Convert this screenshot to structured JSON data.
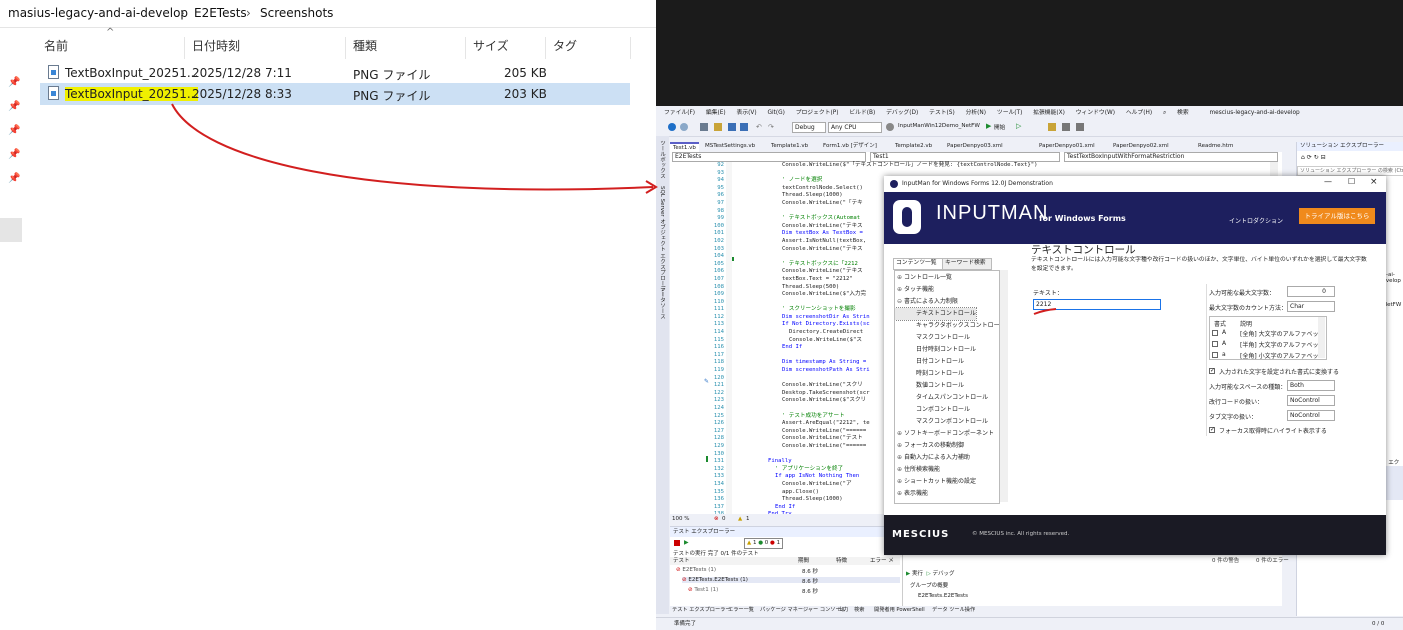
{
  "explorer": {
    "breadcrumb": [
      "masius-legacy-and-ai-develop",
      "E2ETests",
      "Screenshots"
    ],
    "columns": [
      "名前",
      "日付時刻",
      "種類",
      "サイズ",
      "タグ"
    ],
    "files": [
      {
        "name": "TextBoxInput_20251...",
        "date": "2025/12/28 7:11",
        "type": "PNG ファイル",
        "size": "205 KB",
        "selected": false
      },
      {
        "name": "TextBoxInput_20251...",
        "date": "2025/12/28 8:33",
        "type": "PNG ファイル",
        "size": "203 KB",
        "selected": true
      }
    ]
  },
  "vs": {
    "menu": [
      "ファイル(F)",
      "編集(E)",
      "表示(V)",
      "Git(G)",
      "プロジェクト(P)",
      "ビルド(B)",
      "デバッグ(D)",
      "テスト(S)",
      "分析(N)",
      "ツール(T)",
      "拡張機能(X)",
      "ウィンドウ(W)",
      "ヘルプ(H)"
    ],
    "search": "検索",
    "solution": "mescius-legacy-and-ai-develop",
    "toolbar": {
      "config": "Debug",
      "platform": "Any CPU",
      "project": "InputManWin12Demo_NetFW",
      "start": "開始"
    },
    "doc_tabs": [
      "Test1.vb",
      "MSTestSettings.vb",
      "Template1.vb",
      "Form1.vb [デザイン]",
      "Template2.vb",
      "PaperDenpyo03.xml",
      "PaperDenpyo01.xml",
      "PaperDenpyo02.xml",
      "Readme.htm"
    ],
    "nav": {
      "project": "E2ETests",
      "class": "Test1",
      "member": "TestTextBoxInputWithFormatRestriction"
    },
    "side_tabs": [
      "ツールボックス",
      "SQL Server オブジェクト エクスプローラー",
      "データソース"
    ],
    "line_numbers": [
      "92",
      "93",
      "94",
      "95",
      "96",
      "97",
      "98",
      "99",
      "100",
      "101",
      "102",
      "103",
      "104",
      "105",
      "106",
      "107",
      "108",
      "109",
      "110",
      "111",
      "112",
      "113",
      "114",
      "115",
      "116",
      "117",
      "118",
      "119",
      "120",
      "121",
      "122",
      "123",
      "124",
      "125",
      "126",
      "127",
      "128",
      "129",
      "130",
      "131",
      "132",
      "133",
      "134",
      "135",
      "136",
      "137",
      "138",
      "139",
      "140",
      "141",
      "142"
    ],
    "code_lines": [
      {
        "t": "Console.WriteLine($\"「テキストコントロール」ノードを発見: {textControlNode.Text}\")",
        "c": "n",
        "i": 6
      },
      {
        "t": "",
        "c": "n",
        "i": 0
      },
      {
        "t": "' ノードを選択",
        "c": "cm",
        "i": 6
      },
      {
        "t": "textControlNode.Select()",
        "c": "n",
        "i": 6
      },
      {
        "t": "Thread.Sleep(1000)",
        "c": "n",
        "i": 6
      },
      {
        "t": "Console.WriteLine(\"「テキ",
        "c": "n",
        "i": 6
      },
      {
        "t": "",
        "c": "n",
        "i": 0
      },
      {
        "t": "' テキストボックス(Automat",
        "c": "cm",
        "i": 6
      },
      {
        "t": "Console.WriteLine(\"テキス",
        "c": "n",
        "i": 6
      },
      {
        "t": "Dim textBox As TextBox =",
        "c": "kw",
        "i": 6
      },
      {
        "t": "Assert.IsNotNull(textBox,",
        "c": "n",
        "i": 6
      },
      {
        "t": "Console.WriteLine(\"テキス",
        "c": "n",
        "i": 6
      },
      {
        "t": "",
        "c": "n",
        "i": 0
      },
      {
        "t": "' テキストボックスに「2212",
        "c": "cm",
        "i": 6
      },
      {
        "t": "Console.WriteLine(\"テキス",
        "c": "n",
        "i": 6
      },
      {
        "t": "textBox.Text = \"2212\"",
        "c": "n",
        "i": 6
      },
      {
        "t": "Thread.Sleep(500)",
        "c": "n",
        "i": 6
      },
      {
        "t": "Console.WriteLine($\"入力完",
        "c": "n",
        "i": 6
      },
      {
        "t": "",
        "c": "n",
        "i": 0
      },
      {
        "t": "' スクリーンショットを撮影",
        "c": "cm",
        "i": 6
      },
      {
        "t": "Dim screenshotDir As Strin",
        "c": "kw",
        "i": 6
      },
      {
        "t": "If Not Directory.Exists(sc",
        "c": "kw",
        "i": 6
      },
      {
        "t": "Directory.CreateDirect",
        "c": "n",
        "i": 7
      },
      {
        "t": "Console.WriteLine($\"ス",
        "c": "n",
        "i": 7
      },
      {
        "t": "End If",
        "c": "kw",
        "i": 6
      },
      {
        "t": "",
        "c": "n",
        "i": 0
      },
      {
        "t": "Dim timestamp As String =",
        "c": "kw",
        "i": 6
      },
      {
        "t": "Dim screenshotPath As Stri",
        "c": "kw",
        "i": 6
      },
      {
        "t": "",
        "c": "n",
        "i": 0
      },
      {
        "t": "Console.WriteLine(\"スクリ",
        "c": "n",
        "i": 6
      },
      {
        "t": "Desktop.TakeScreenshot(scr",
        "c": "n",
        "i": 6
      },
      {
        "t": "Console.WriteLine($\"スクリ",
        "c": "n",
        "i": 6
      },
      {
        "t": "",
        "c": "n",
        "i": 0
      },
      {
        "t": "' テスト成功をアサート",
        "c": "cm",
        "i": 6
      },
      {
        "t": "Assert.AreEqual(\"2212\", te",
        "c": "n",
        "i": 6
      },
      {
        "t": "Console.WriteLine(\"======",
        "c": "n",
        "i": 6
      },
      {
        "t": "Console.WriteLine(\"テスト",
        "c": "n",
        "i": 6
      },
      {
        "t": "Console.WriteLine(\"======",
        "c": "n",
        "i": 6
      },
      {
        "t": "",
        "c": "n",
        "i": 0
      },
      {
        "t": "Finally",
        "c": "kw",
        "i": 4
      },
      {
        "t": "' アプリケーションを終了",
        "c": "cm",
        "i": 5
      },
      {
        "t": "If app IsNot Nothing Then",
        "c": "kw",
        "i": 5
      },
      {
        "t": "Console.WriteLine(\"ア",
        "c": "n",
        "i": 6
      },
      {
        "t": "app.Close()",
        "c": "n",
        "i": 6
      },
      {
        "t": "Thread.Sleep(1000)",
        "c": "n",
        "i": 6
      },
      {
        "t": "End If",
        "c": "kw",
        "i": 5
      },
      {
        "t": "End Try",
        "c": "kw",
        "i": 4
      },
      {
        "t": "End Sub",
        "c": "kw",
        "i": 3
      },
      {
        "t": "End Class",
        "c": "kw",
        "i": 2
      },
      {
        "t": "End Namespace",
        "c": "kw",
        "i": 0
      },
      {
        "t": "",
        "c": "n",
        "i": 0
      }
    ],
    "status_row": {
      "zoom": "100 %",
      "errors": "0",
      "warnings": "1"
    },
    "test_explorer": {
      "title": "テスト エクスプローラー",
      "summary": "テストの実行 完了 0/1 件のテスト",
      "counts": [
        "1",
        "0",
        "1"
      ],
      "columns": [
        "テスト",
        "期間",
        "特徴",
        "エラー メ"
      ],
      "rows": [
        {
          "name": "E2ETests (1)",
          "dur": "8.6 秒",
          "indent": 1
        },
        {
          "name": "E2ETests.E2ETests (1)",
          "dur": "8.6 秒",
          "indent": 2
        },
        {
          "name": "Test1 (1)",
          "dur": "8.6 秒",
          "indent": 3
        }
      ],
      "detail_buttons": [
        "実行",
        "デバッグ"
      ],
      "group_title": "グループの概要",
      "group_name": "E2ETests.E2ETests"
    },
    "bottom_tabs": [
      "テスト エクスプローラー",
      "エラー一覧",
      "パッケージ マネージャー コンソール",
      "出力",
      "検索",
      "開発者用 PowerShell",
      "データ ツール操作"
    ],
    "status": {
      "ready": "準備完了",
      "errors_label": "0 件の警告",
      "errors2": "0 件のエラー",
      "pos": "0 / 0"
    },
    "solution_explorer": {
      "title": "ソリューション エクスプローラー",
      "search": "ソリューション エクスプローラー の検索 (Ctrl+:)",
      "snip1": "nd-ai-develop",
      "snip2": "NetFW",
      "snip3": "ン エク"
    }
  },
  "inputman": {
    "title": "InputMan for Windows Forms 12.0J Demonstration",
    "logo_text": "INPUTMAN",
    "logo_sub": "for Windows Forms",
    "intro": "イントロダクション",
    "trial_button": "トライアル版はこちら",
    "tabs": [
      "コンテンツ一覧",
      "キーワード検索"
    ],
    "tree": [
      {
        "label": "コントロール一覧",
        "level": 0,
        "sign": "+"
      },
      {
        "label": "タッチ機能",
        "level": 0,
        "sign": "+"
      },
      {
        "label": "書式による入力制限",
        "level": 0,
        "sign": "-"
      },
      {
        "label": "テキストコントロール",
        "level": 1,
        "sign": "",
        "selected": true
      },
      {
        "label": "キャラクタボックスコントロール",
        "level": 1,
        "sign": ""
      },
      {
        "label": "マスクコントロール",
        "level": 1,
        "sign": ""
      },
      {
        "label": "日付時刻コントロール",
        "level": 1,
        "sign": ""
      },
      {
        "label": "日付コントロール",
        "level": 1,
        "sign": ""
      },
      {
        "label": "時刻コントロール",
        "level": 1,
        "sign": ""
      },
      {
        "label": "数値コントロール",
        "level": 1,
        "sign": ""
      },
      {
        "label": "タイムスパンコントロール",
        "level": 1,
        "sign": ""
      },
      {
        "label": "コンボコントロール",
        "level": 1,
        "sign": ""
      },
      {
        "label": "マスクコンボコントロール",
        "level": 1,
        "sign": ""
      },
      {
        "label": "ソフトキーボードコンポーネント",
        "level": 0,
        "sign": "+"
      },
      {
        "label": "フォーカスの移動制御",
        "level": 0,
        "sign": "+"
      },
      {
        "label": "自動入力による入力補助",
        "level": 0,
        "sign": "+"
      },
      {
        "label": "住所検索機能",
        "level": 0,
        "sign": "+"
      },
      {
        "label": "ショートカット機能の設定",
        "level": 0,
        "sign": "+"
      },
      {
        "label": "表示機能",
        "level": 0,
        "sign": "+"
      }
    ],
    "heading": "テキストコントロール",
    "description": "テキストコントロールには入力可能な文字種や改行コードの扱いのほか、文字単位、バイト単位のいずれかを選択して最大文字数を設定できます。",
    "text_label": "テキスト：",
    "text_value": "2212",
    "props": {
      "max_chars_label": "入力可能な最大文字数：",
      "max_chars_value": "0",
      "count_method_label": "最大文字数のカウント方法：",
      "count_method_value": "Char",
      "format_col": "書式",
      "desc_col": "説明",
      "format_rows": [
        {
          "fmt": "A",
          "desc": "[全角] 大文字のアルファベット"
        },
        {
          "fmt": "A",
          "desc": "[半角] 大文字のアルファベット"
        },
        {
          "fmt": "a",
          "desc": "[全角] 小文字のアルファベット"
        }
      ],
      "convert_label": "入力された文字を設定された書式に変換する",
      "space_label": "入力可能なスペースの種類：",
      "space_value": "Both",
      "crlf_label": "改行コードの扱い：",
      "crlf_value": "NoControl",
      "tab_label": "タブ文字の扱い：",
      "tab_value": "NoControl",
      "highlight_label": "フォーカス取得時にハイライト表示する"
    },
    "footer_logo": "MESCIUS",
    "copyright": "© MESCIUS inc. All rights reserved."
  }
}
